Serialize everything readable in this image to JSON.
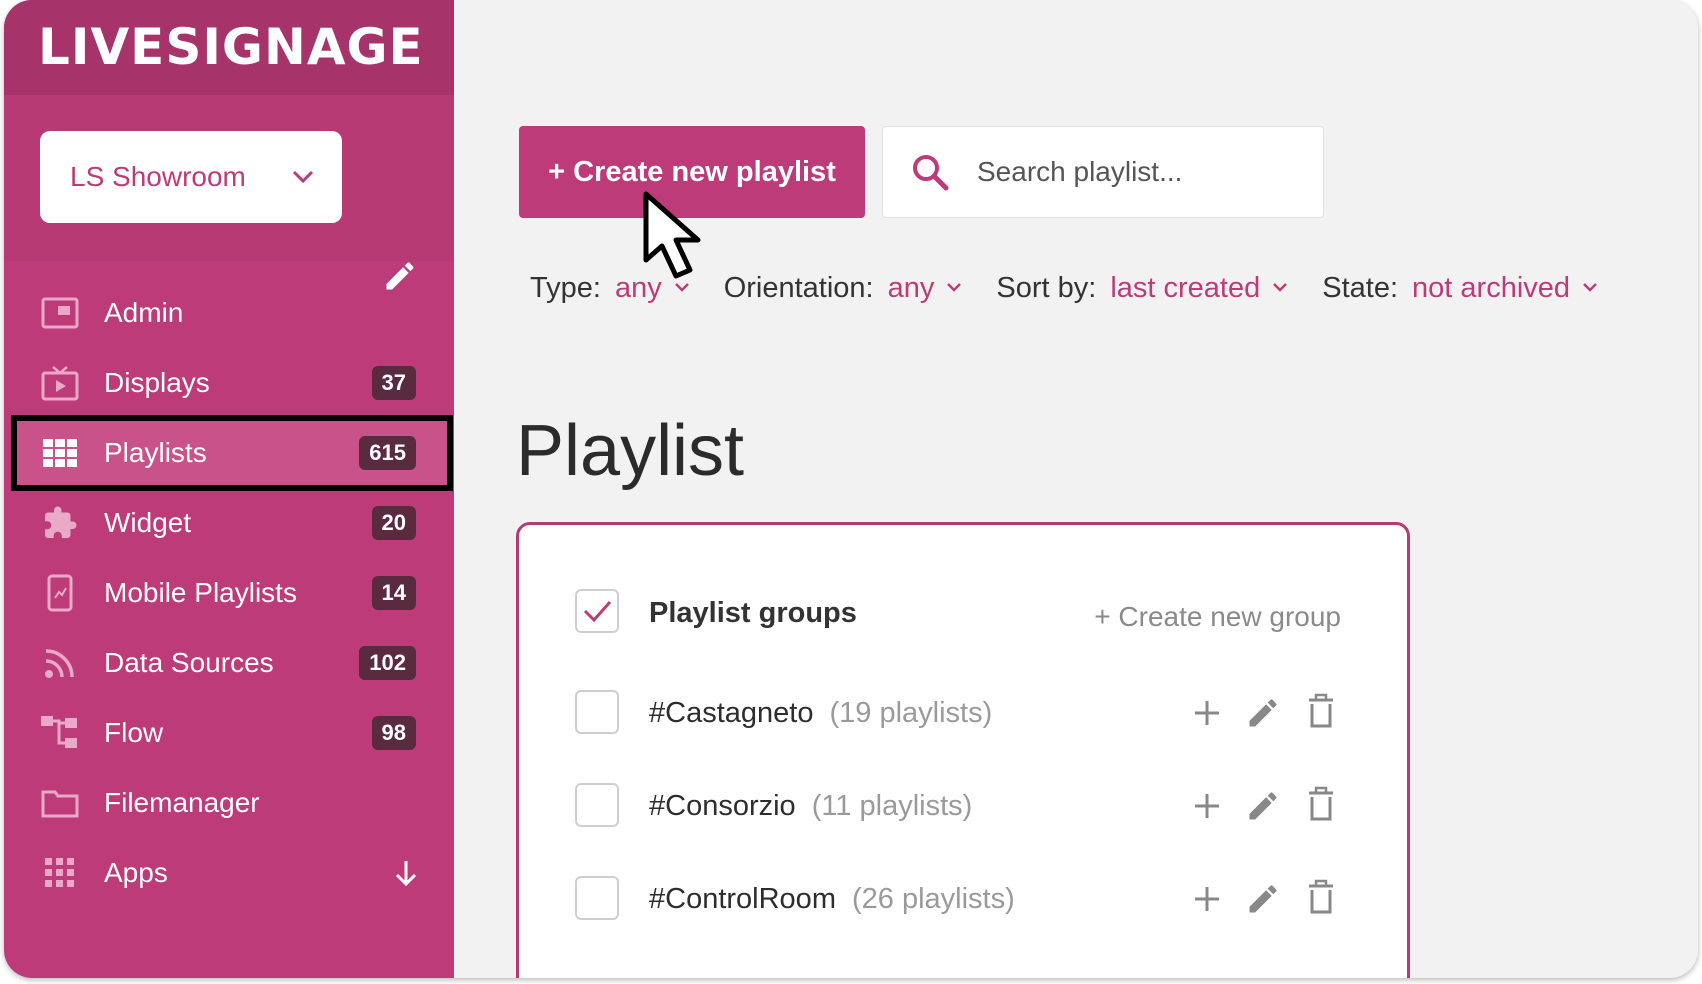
{
  "app": {
    "logo_text": "LIVESIGNAGE",
    "brand_color": "#bd3b79",
    "badge_color": "#5a2a3f"
  },
  "workspace": {
    "selected": "LS Showroom",
    "icon": "chevron-down-icon"
  },
  "sidebar": {
    "edit_icon": "pencil-icon",
    "items": [
      {
        "label": "Admin",
        "icon": "admin-window-icon",
        "badge": ""
      },
      {
        "label": "Displays",
        "icon": "tv-display-icon",
        "badge": "37"
      },
      {
        "label": "Playlists",
        "icon": "grid-icon",
        "badge": "615",
        "active": true
      },
      {
        "label": "Widget",
        "icon": "puzzle-icon",
        "badge": "20"
      },
      {
        "label": "Mobile Playlists",
        "icon": "mobile-icon",
        "badge": "14"
      },
      {
        "label": "Data Sources",
        "icon": "rss-icon",
        "badge": "102"
      },
      {
        "label": "Flow",
        "icon": "flow-icon",
        "badge": "98"
      },
      {
        "label": "Filemanager",
        "icon": "folder-icon",
        "badge": ""
      },
      {
        "label": "Apps",
        "icon": "apps-grid-icon",
        "badge": ""
      }
    ]
  },
  "toolbar": {
    "create_label": "+ Create new playlist",
    "search_placeholder": "Search playlist..."
  },
  "filters": [
    {
      "label": "Type:",
      "value": "any"
    },
    {
      "label": "Orientation:",
      "value": "any"
    },
    {
      "label": "Sort by:",
      "value": "last created"
    },
    {
      "label": "State:",
      "value": "not archived"
    }
  ],
  "page": {
    "title": "Playlist"
  },
  "groups": {
    "header_label": "Playlist groups",
    "header_checked": true,
    "create_group_label": "+ Create new group",
    "rows": [
      {
        "name": "#Castagneto",
        "count": "(19 playlists)"
      },
      {
        "name": "#Consorzio",
        "count": "(11 playlists)"
      },
      {
        "name": "#ControlRoom",
        "count": "(26 playlists)"
      }
    ]
  }
}
